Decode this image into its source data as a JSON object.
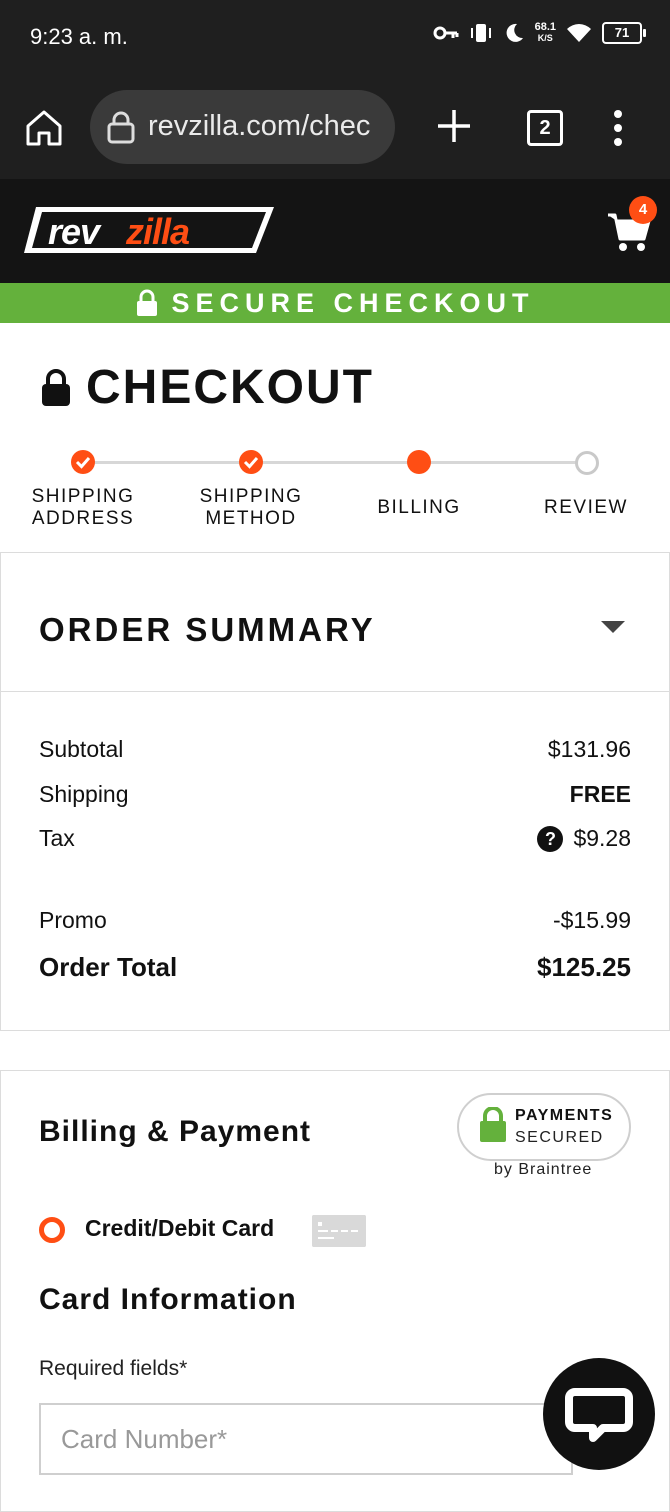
{
  "status_bar": {
    "time": "9:23 a. m.",
    "net_speed": "68.1",
    "net_unit": "K/S",
    "battery": "71"
  },
  "browser": {
    "url": "revzilla.com/chec",
    "tab_count": "2"
  },
  "site": {
    "brand": "revzilla",
    "cart_count": "4"
  },
  "secure_banner": "SECURE CHECKOUT",
  "checkout_title": "CHECKOUT",
  "steps": [
    {
      "line1": "SHIPPING",
      "line2": "ADDRESS",
      "state": "done"
    },
    {
      "line1": "SHIPPING",
      "line2": "METHOD",
      "state": "done"
    },
    {
      "line1": "BILLING",
      "line2": "",
      "state": "current"
    },
    {
      "line1": "REVIEW",
      "line2": "",
      "state": "todo"
    }
  ],
  "order_summary": {
    "title": "ORDER SUMMARY",
    "subtotal_label": "Subtotal",
    "subtotal": "$131.96",
    "shipping_label": "Shipping",
    "shipping": "FREE",
    "tax_label": "Tax",
    "tax": "$9.28",
    "promo_label": "Promo",
    "promo": "-$15.99",
    "total_label": "Order Total",
    "total": "$125.25"
  },
  "billing": {
    "title": "Billing & Payment",
    "badge_line1": "PAYMENTS",
    "badge_line2": "SECURED",
    "badge_by": "by Braintree",
    "method_label": "Credit/Debit Card",
    "card_info_title": "Card Information",
    "required_note": "Required fields*",
    "card_number_placeholder": "Card Number*"
  },
  "colors": {
    "accent": "#ff4e14",
    "secure_green": "#64b13c",
    "header_bg": "#141414"
  }
}
